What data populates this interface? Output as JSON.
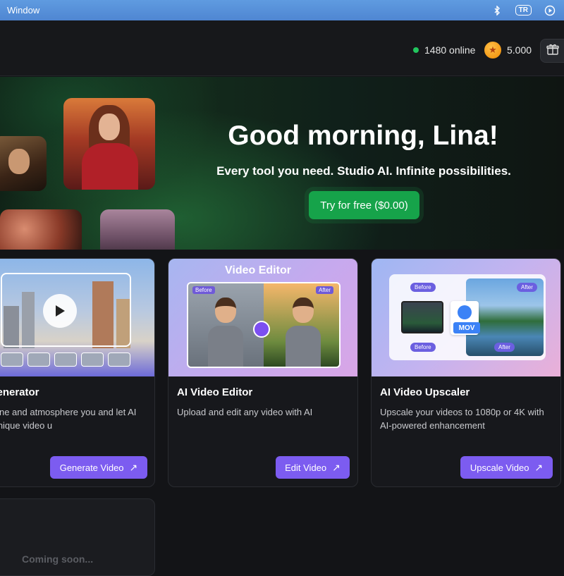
{
  "os_bar": {
    "title": "Window",
    "tr_badge": "TR"
  },
  "header": {
    "online_count": "1480 online",
    "coins": "5.000"
  },
  "hero": {
    "title": "Good morning, Lina!",
    "subtitle": "Every tool you need. Studio AI. Infinite possibilities.",
    "cta": "Try for free ($0.00)"
  },
  "cards": [
    {
      "title": "AI Video Generator",
      "title_visible": "deo Generator",
      "desc_visible": "be the scene and atmosphere you and let AI create a unique video u",
      "button": "Generate Video"
    },
    {
      "title": "AI Video Editor",
      "thumb_label": "Video Editor",
      "thumb_before": "Before",
      "thumb_after": "After",
      "desc": "Upload and edit any video with AI",
      "button": "Edit Video"
    },
    {
      "title": "AI Video Upscaler",
      "thumb_before": "Before",
      "thumb_after": "After",
      "thumb_format": "MOV",
      "desc": "Upscale your videos to 1080p or 4K with AI-powered enhancement",
      "button": "Upscale Video"
    }
  ],
  "coming_soon": "Coming soon...",
  "colors": {
    "accent_purple": "#7c5cf0",
    "cta_green": "#16a34a",
    "online_dot": "#22c55e"
  }
}
